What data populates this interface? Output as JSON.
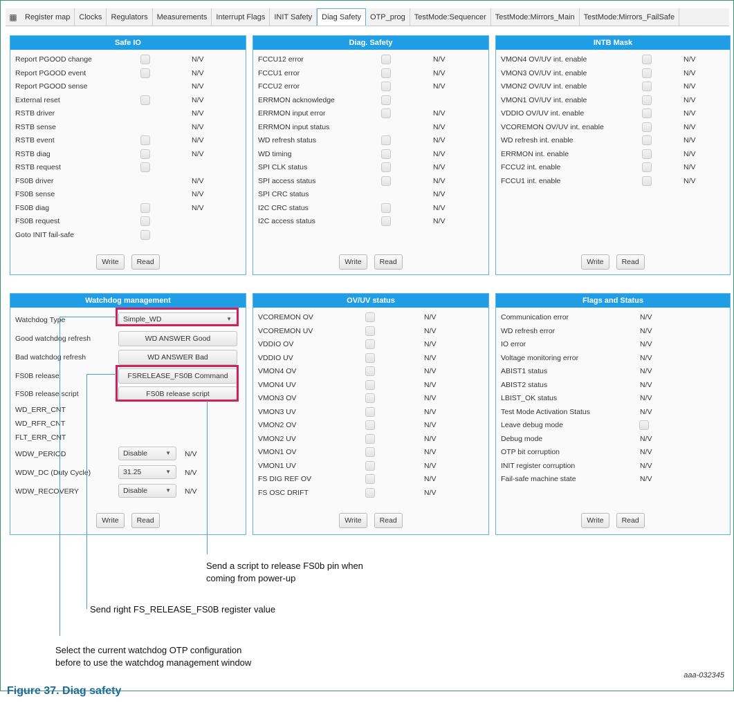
{
  "tabs": [
    "Register map",
    "Clocks",
    "Regulators",
    "Measurements",
    "Interrupt Flags",
    "INIT Safety",
    "Diag Safety",
    "OTP_prog",
    "TestMode:Sequencer",
    "TestMode:Mirrors_Main",
    "TestMode:Mirrors_FailSafe"
  ],
  "active_tab": "Diag Safety",
  "buttons": {
    "write": "Write",
    "read": "Read"
  },
  "safe_io": {
    "title": "Safe IO",
    "rows": [
      {
        "label": "Report PGOOD change",
        "checkbox": true,
        "value": "N/V"
      },
      {
        "label": "Report PGOOD event",
        "checkbox": true,
        "value": "N/V"
      },
      {
        "label": "Report PGOOD sense",
        "checkbox": false,
        "value": "N/V"
      },
      {
        "label": "External reset",
        "checkbox": true,
        "value": "N/V"
      },
      {
        "label": "RSTB driver",
        "checkbox": false,
        "value": "N/V"
      },
      {
        "label": "RSTB sense",
        "checkbox": false,
        "value": "N/V"
      },
      {
        "label": "RSTB event",
        "checkbox": true,
        "value": "N/V"
      },
      {
        "label": "RSTB diag",
        "checkbox": true,
        "value": "N/V"
      },
      {
        "label": "RSTB request",
        "checkbox": true,
        "value": ""
      },
      {
        "label": "FS0B driver",
        "checkbox": false,
        "value": "N/V"
      },
      {
        "label": "FS0B sense",
        "checkbox": false,
        "value": "N/V"
      },
      {
        "label": "FS0B diag",
        "checkbox": true,
        "value": "N/V"
      },
      {
        "label": "FS0B request",
        "checkbox": true,
        "value": ""
      },
      {
        "label": "Goto INIT fail-safe",
        "checkbox": true,
        "value": ""
      }
    ]
  },
  "diag_safety": {
    "title": "Diag. Safety",
    "rows": [
      {
        "label": "FCCU12 error",
        "checkbox": true,
        "value": "N/V"
      },
      {
        "label": "FCCU1 error",
        "checkbox": true,
        "value": "N/V"
      },
      {
        "label": "FCCU2 error",
        "checkbox": true,
        "value": "N/V"
      },
      {
        "label": "ERRMON acknowledge",
        "checkbox": true,
        "value": ""
      },
      {
        "label": "ERRMON input error",
        "checkbox": true,
        "value": "N/V"
      },
      {
        "label": "ERRMON input status",
        "checkbox": false,
        "value": "N/V"
      },
      {
        "label": "WD refresh status",
        "checkbox": true,
        "value": "N/V"
      },
      {
        "label": "WD timing",
        "checkbox": true,
        "value": "N/V"
      },
      {
        "label": "SPI CLK status",
        "checkbox": true,
        "value": "N/V"
      },
      {
        "label": "SPI access status",
        "checkbox": true,
        "value": "N/V"
      },
      {
        "label": "SPI CRC status",
        "checkbox": false,
        "value": "N/V"
      },
      {
        "label": "I2C CRC status",
        "checkbox": true,
        "value": "N/V"
      },
      {
        "label": "I2C access status",
        "checkbox": true,
        "value": "N/V"
      }
    ]
  },
  "intb_mask": {
    "title": "INTB Mask",
    "rows": [
      {
        "label": "VMON4 OV/UV int. enable",
        "checkbox": true,
        "value": "N/V"
      },
      {
        "label": "VMON3 OV/UV int. enable",
        "checkbox": true,
        "value": "N/V"
      },
      {
        "label": "VMON2 OV/UV int. enable",
        "checkbox": true,
        "value": "N/V"
      },
      {
        "label": "VMON1 OV/UV int. enable",
        "checkbox": true,
        "value": "N/V"
      },
      {
        "label": "VDDIO OV/UV int. enable",
        "checkbox": true,
        "value": "N/V"
      },
      {
        "label": "VCOREMON OV/UV int. enable",
        "checkbox": true,
        "value": "N/V"
      },
      {
        "label": "WD refresh int. enable",
        "checkbox": true,
        "value": "N/V"
      },
      {
        "label": "ERRMON int. enable",
        "checkbox": true,
        "value": "N/V"
      },
      {
        "label": "FCCU2 int. enable",
        "checkbox": true,
        "value": "N/V"
      },
      {
        "label": "FCCU1 int. enable",
        "checkbox": true,
        "value": "N/V"
      }
    ]
  },
  "watchdog": {
    "title": "Watchdog management",
    "type_label": "Watchdog Type",
    "type_value": "Simple_WD",
    "good_label": "Good watchdog refresh",
    "good_button": "WD ANSWER Good",
    "bad_label": "Bad watchdog refresh",
    "bad_button": "WD ANSWER Bad",
    "fs0b_label": "FS0B release",
    "fs0b_button": "FSRELEASE_FS0B Command",
    "script_label": "FS0B release script",
    "script_button": "FS0B release script",
    "err_cnt": "WD_ERR_CNT",
    "rfr_cnt": "WD_RFR_CNT",
    "flt_cnt": "FLT_ERR_CNT",
    "period_label": "WDW_PERIOD",
    "period_value": "Disable",
    "period_nv": "N/V",
    "dc_label": "WDW_DC (Duty Cycle)",
    "dc_value": "31.25",
    "dc_nv": "N/V",
    "recovery_label": "WDW_RECOVERY",
    "recovery_value": "Disable",
    "recovery_nv": "N/V"
  },
  "ovuv": {
    "title": "OV/UV status",
    "rows": [
      {
        "label": "VCOREMON OV",
        "checkbox": true,
        "value": "N/V"
      },
      {
        "label": "VCOREMON UV",
        "checkbox": true,
        "value": "N/V"
      },
      {
        "label": "VDDIO OV",
        "checkbox": true,
        "value": "N/V"
      },
      {
        "label": "VDDIO UV",
        "checkbox": true,
        "value": "N/V"
      },
      {
        "label": "VMON4 OV",
        "checkbox": true,
        "value": "N/V"
      },
      {
        "label": "VMON4 UV",
        "checkbox": true,
        "value": "N/V"
      },
      {
        "label": "VMON3 OV",
        "checkbox": true,
        "value": "N/V"
      },
      {
        "label": "VMON3 UV",
        "checkbox": true,
        "value": "N/V"
      },
      {
        "label": "VMON2 OV",
        "checkbox": true,
        "value": "N/V"
      },
      {
        "label": "VMON2 UV",
        "checkbox": true,
        "value": "N/V"
      },
      {
        "label": "VMON1 OV",
        "checkbox": true,
        "value": "N/V"
      },
      {
        "label": "VMON1 UV",
        "checkbox": true,
        "value": "N/V"
      },
      {
        "label": "FS DIG REF OV",
        "checkbox": true,
        "value": "N/V"
      },
      {
        "label": "FS OSC DRIFT",
        "checkbox": true,
        "value": "N/V"
      }
    ]
  },
  "flags_status": {
    "title": "Flags and Status",
    "rows": [
      {
        "label": "Communication error",
        "checkbox": false,
        "value": "N/V"
      },
      {
        "label": "WD refresh error",
        "checkbox": false,
        "value": "N/V"
      },
      {
        "label": "IO error",
        "checkbox": false,
        "value": "N/V"
      },
      {
        "label": "Voltage monitoring error",
        "checkbox": false,
        "value": "N/V"
      },
      {
        "label": "ABIST1 status",
        "checkbox": false,
        "value": "N/V"
      },
      {
        "label": "ABIST2 status",
        "checkbox": false,
        "value": "N/V"
      },
      {
        "label": "LBIST_OK status",
        "checkbox": false,
        "value": "N/V"
      },
      {
        "label": "Test Mode Activation Status",
        "checkbox": false,
        "value": "N/V"
      },
      {
        "label": "Leave debug mode",
        "checkbox": true,
        "value": ""
      },
      {
        "label": "Debug mode",
        "checkbox": false,
        "value": "N/V"
      },
      {
        "label": "OTP bit corruption",
        "checkbox": false,
        "value": "N/V"
      },
      {
        "label": "INIT register corruption",
        "checkbox": false,
        "value": "N/V"
      },
      {
        "label": "Fail-safe machine state",
        "checkbox": false,
        "value": "N/V"
      }
    ]
  },
  "annotations": {
    "script_line1": "Send a script to release FS0b pin when",
    "script_line2": "coming from power-up",
    "fs0b": "Send right FS_RELEASE_FS0B register value",
    "type_line1": "Select the current watchdog OTP configuration",
    "type_line2": "before to use the watchdog management window"
  },
  "figure_id": "aaa-032345",
  "figure_caption": "Figure 37. Diag safety"
}
